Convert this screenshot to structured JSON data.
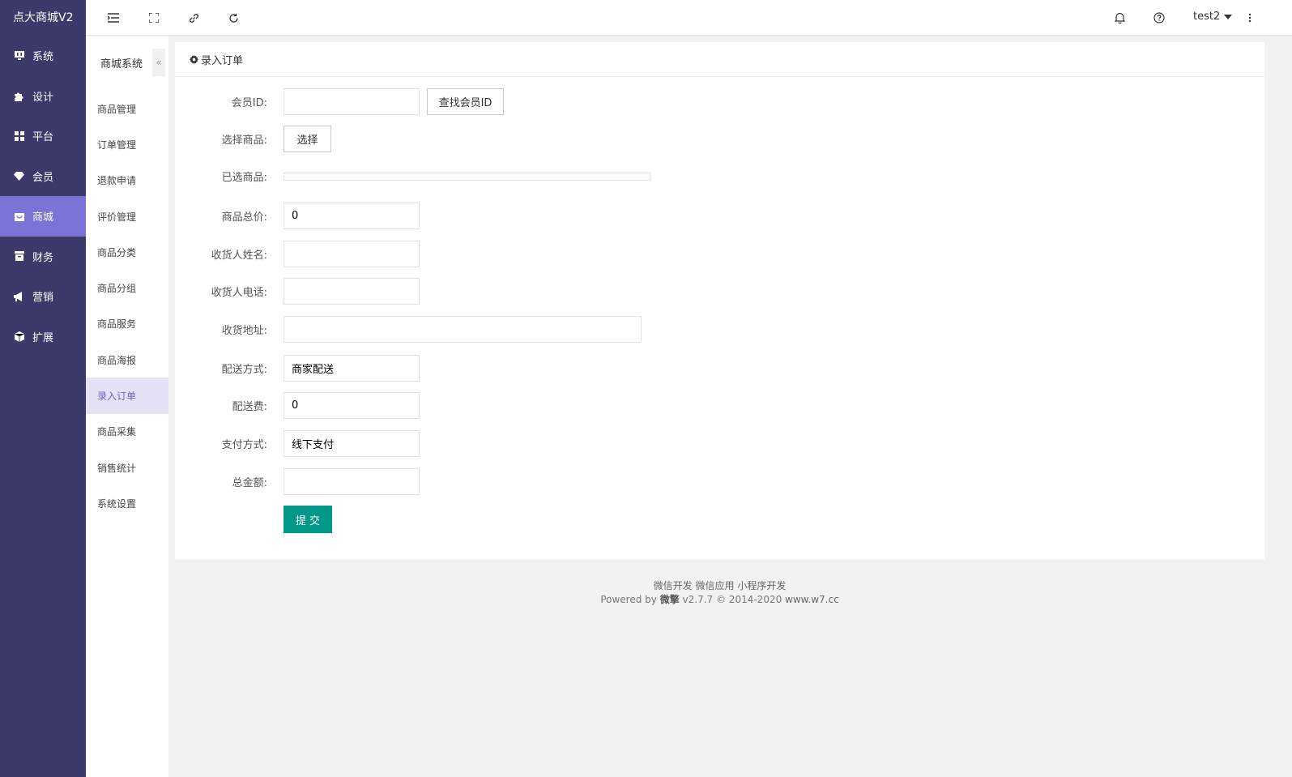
{
  "app": {
    "logo": "点大商城V2"
  },
  "sidebar": {
    "items": [
      {
        "label": "系统",
        "icon": "monitor-icon"
      },
      {
        "label": "设计",
        "icon": "puzzle-icon"
      },
      {
        "label": "平台",
        "icon": "grid-icon"
      },
      {
        "label": "会员",
        "icon": "diamond-icon"
      },
      {
        "label": "商城",
        "icon": "shop-icon",
        "active": true
      },
      {
        "label": "财务",
        "icon": "archive-icon"
      },
      {
        "label": "营销",
        "icon": "megaphone-icon"
      },
      {
        "label": "扩展",
        "icon": "cube-icon"
      }
    ]
  },
  "topbar": {
    "user": "test2"
  },
  "subnav": {
    "title": "商城系统",
    "collapse": "«",
    "items": [
      {
        "label": "商品管理"
      },
      {
        "label": "订单管理"
      },
      {
        "label": "退款申请"
      },
      {
        "label": "评价管理"
      },
      {
        "label": "商品分类"
      },
      {
        "label": "商品分组"
      },
      {
        "label": "商品服务"
      },
      {
        "label": "商品海报"
      },
      {
        "label": "录入订单",
        "active": true
      },
      {
        "label": "商品采集"
      },
      {
        "label": "销售统计"
      },
      {
        "label": "系统设置"
      }
    ]
  },
  "page": {
    "title": "录入订单",
    "form": {
      "member_id_label": "会员ID:",
      "member_id_value": "",
      "find_member_btn": "查找会员ID",
      "select_goods_label": "选择商品:",
      "select_btn": "选择",
      "selected_goods_label": "已选商品:",
      "total_goods_label": "商品总价:",
      "total_goods_value": "0",
      "receiver_name_label": "收货人姓名:",
      "receiver_name_value": "",
      "receiver_phone_label": "收货人电话:",
      "receiver_phone_value": "",
      "address_label": "收货地址:",
      "address_value": "",
      "delivery_label": "配送方式:",
      "delivery_value": "商家配送",
      "freight_label": "配送费:",
      "freight_value": "0",
      "payment_label": "支付方式:",
      "payment_value": "线下支付",
      "total_amount_label": "总金额:",
      "total_amount_value": "",
      "submit_btn": "提 交"
    }
  },
  "footer": {
    "links": [
      "微信开发",
      "微信应用",
      "小程序开发"
    ],
    "powered": "Powered by",
    "brand": "微擎",
    "version": "v2.7.7 © 2014-2020",
    "site": "www.w7.cc"
  },
  "colors": {
    "sidebar": "#3c3a6b",
    "sidebar_active": "#7b73d6",
    "submit": "#009688"
  }
}
